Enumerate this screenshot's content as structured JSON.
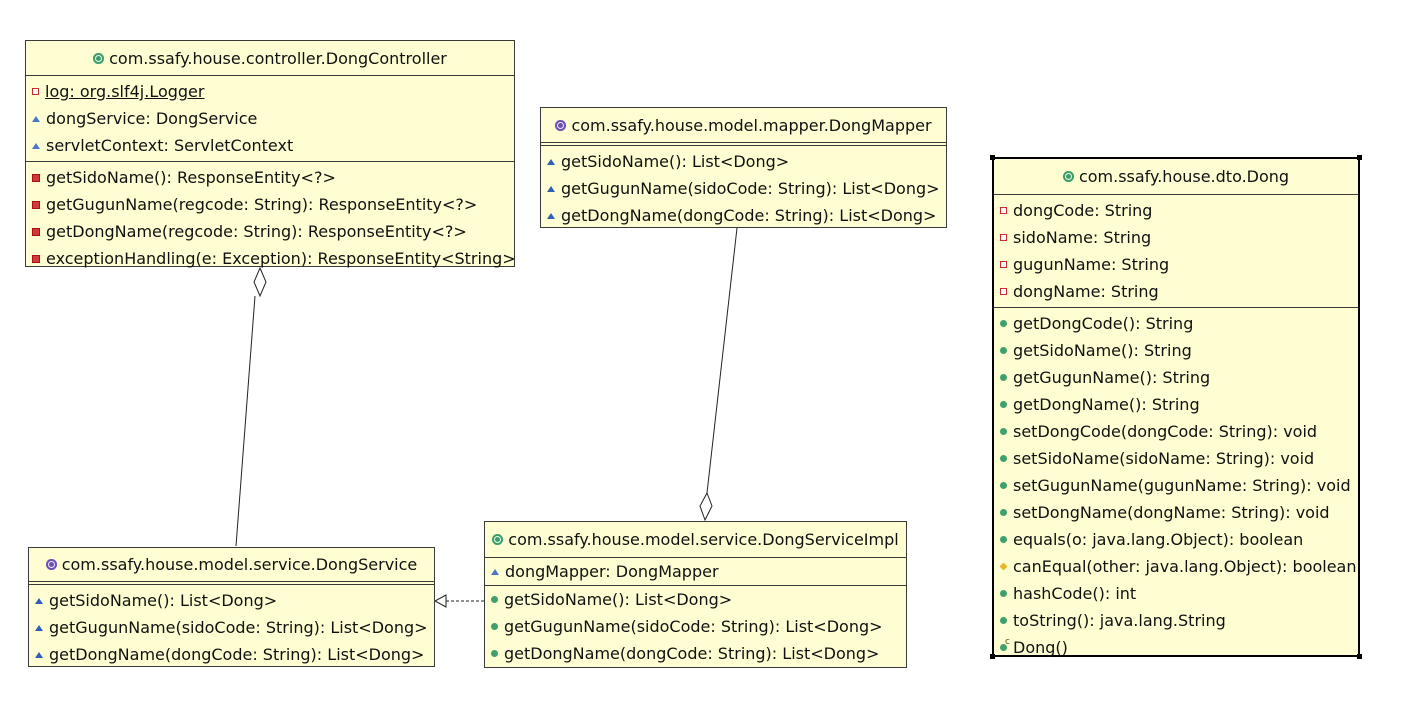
{
  "classes": {
    "dong_controller": {
      "title": "com.ssafy.house.controller.DongController",
      "kind_icon": "class-icon",
      "fields": [
        {
          "icon": "private-static",
          "text": " log: org.slf4j.Logger"
        },
        {
          "icon": "package",
          "text": "dongService: DongService"
        },
        {
          "icon": "package",
          "text": "servletContext: ServletContext"
        }
      ],
      "methods": [
        {
          "icon": "private-method",
          "text": "getSidoName(): ResponseEntity<?>"
        },
        {
          "icon": "private-method",
          "text": "getGugunName(regcode: String): ResponseEntity<?>"
        },
        {
          "icon": "private-method",
          "text": "getDongName(regcode: String): ResponseEntity<?>"
        },
        {
          "icon": "private-method",
          "text": "exceptionHandling(e: Exception): ResponseEntity<String>"
        }
      ]
    },
    "dong_mapper": {
      "title": "com.ssafy.house.model.mapper.DongMapper",
      "kind_icon": "interface-icon",
      "methods": [
        {
          "icon": "package-method",
          "text": "getSidoName(): List<Dong>"
        },
        {
          "icon": "package-method",
          "text": "getGugunName(sidoCode: String): List<Dong>"
        },
        {
          "icon": "package-method",
          "text": "getDongName(dongCode: String): List<Dong>"
        }
      ]
    },
    "dong_dto": {
      "title": "com.ssafy.house.dto.Dong",
      "kind_icon": "class-icon",
      "fields": [
        {
          "icon": "private",
          "text": "dongCode: String"
        },
        {
          "icon": "private",
          "text": "sidoName: String"
        },
        {
          "icon": "private",
          "text": "gugunName: String"
        },
        {
          "icon": "private",
          "text": "dongName: String"
        }
      ],
      "methods": [
        {
          "icon": "public",
          "text": "getDongCode(): String"
        },
        {
          "icon": "public",
          "text": "getSidoName(): String"
        },
        {
          "icon": "public",
          "text": "getGugunName(): String"
        },
        {
          "icon": "public",
          "text": "getDongName(): String"
        },
        {
          "icon": "public",
          "text": "setDongCode(dongCode: String): void"
        },
        {
          "icon": "public",
          "text": "setSidoName(sidoName: String): void"
        },
        {
          "icon": "public",
          "text": "setGugunName(gugunName: String): void"
        },
        {
          "icon": "public",
          "text": "setDongName(dongName: String): void"
        },
        {
          "icon": "public",
          "text": "equals(o: java.lang.Object): boolean"
        },
        {
          "icon": "protected",
          "text": "canEqual(other: java.lang.Object): boolean"
        },
        {
          "icon": "public",
          "text": "hashCode(): int"
        },
        {
          "icon": "public",
          "text": "toString(): java.lang.String"
        },
        {
          "icon": "constructor",
          "text": "Dong()"
        }
      ]
    },
    "dong_service": {
      "title": "com.ssafy.house.model.service.DongService",
      "kind_icon": "interface-icon",
      "methods": [
        {
          "icon": "package-method",
          "text": "getSidoName(): List<Dong>"
        },
        {
          "icon": "package-method",
          "text": "getGugunName(sidoCode: String): List<Dong>"
        },
        {
          "icon": "package-method",
          "text": "getDongName(dongCode: String): List<Dong>"
        }
      ]
    },
    "dong_service_impl": {
      "title": "com.ssafy.house.model.service.DongServiceImpl",
      "kind_icon": "class-icon",
      "fields": [
        {
          "icon": "package",
          "text": "dongMapper: DongMapper"
        }
      ],
      "methods": [
        {
          "icon": "public",
          "text": "getSidoName(): List<Dong>"
        },
        {
          "icon": "public",
          "text": "getGugunName(sidoCode: String): List<Dong>"
        },
        {
          "icon": "public",
          "text": "getDongName(dongCode: String): List<Dong>"
        }
      ]
    }
  },
  "relations": [
    {
      "from": "dong_controller",
      "to": "dong_service",
      "type": "aggregation"
    },
    {
      "from": "dong_service_impl",
      "to": "dong_mapper",
      "type": "aggregation"
    },
    {
      "from": "dong_service_impl",
      "to": "dong_service",
      "type": "realization"
    }
  ],
  "colors": {
    "box_fill": "#fefed2",
    "box_border": "#3a3a3a"
  }
}
